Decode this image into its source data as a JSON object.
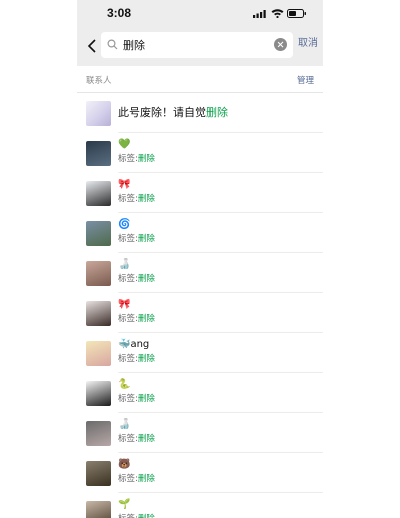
{
  "status": {
    "time": "3:08"
  },
  "search": {
    "query": "删除",
    "cancel_label": "取消"
  },
  "section": {
    "label": "联系人",
    "manage_label": "管理"
  },
  "first_result": {
    "name_prefix": "此号废除！请自觉",
    "name_highlight": "删除"
  },
  "tag_prefix": "标签:",
  "tag_value": "删除",
  "contacts": [
    {
      "name": "💚",
      "avatar_colors": [
        "#2b3a4a",
        "#5a6f82"
      ]
    },
    {
      "name": "🎀",
      "avatar_colors": [
        "#e9ecf0",
        "#2a2a2a"
      ]
    },
    {
      "name": "🌀",
      "avatar_colors": [
        "#7b8fa6",
        "#4e6a4a"
      ]
    },
    {
      "name": "🍶",
      "avatar_colors": [
        "#c9a89b",
        "#7a5a4e"
      ]
    },
    {
      "name": "🎀",
      "avatar_colors": [
        "#e8e2e0",
        "#3a2a26"
      ]
    },
    {
      "name": "🐳ang",
      "avatar_colors": [
        "#f3e6b8",
        "#d8a6a0"
      ]
    },
    {
      "name": "🐍",
      "avatar_colors": [
        "#f4f4f4",
        "#1a1a1a"
      ]
    },
    {
      "name": "🍶",
      "avatar_colors": [
        "#6b6b6b",
        "#b8a8a8"
      ]
    },
    {
      "name": "🐻",
      "avatar_colors": [
        "#8a8070",
        "#3a3020"
      ]
    },
    {
      "name": "🌱",
      "avatar_colors": [
        "#c8b8a8",
        "#4a3a2a"
      ]
    }
  ],
  "colors": {
    "highlight": "#07a14a",
    "link": "#576b95",
    "bar_bg": "#ededed"
  }
}
